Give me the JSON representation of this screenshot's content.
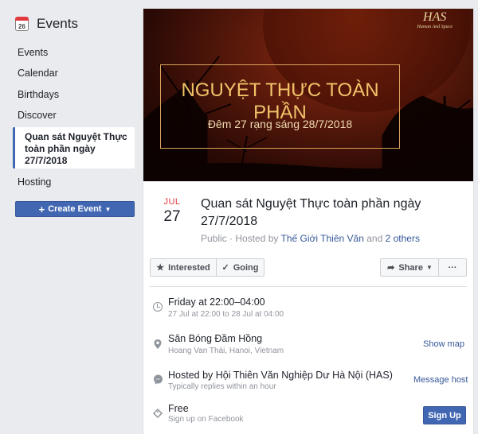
{
  "sidebar": {
    "header_title": "Events",
    "calendar_icon_day": "26",
    "items": [
      {
        "label": "Events"
      },
      {
        "label": "Calendar"
      },
      {
        "label": "Birthdays"
      },
      {
        "label": "Discover"
      },
      {
        "label": "Quan sát Nguyệt Thực toàn phần ngày 27/7/2018"
      },
      {
        "label": "Hosting"
      }
    ],
    "create_button": "Create Event"
  },
  "banner": {
    "logo_mark": "HAS",
    "logo_sub": "Human And Space",
    "title": "NGUYỆT THỰC TOÀN PHẦN",
    "subtitle": "Đêm 27 rạng sáng 28/7/2018"
  },
  "event": {
    "month": "JUL",
    "day": "27",
    "title": "Quan sát Nguyệt Thực toàn phần ngày 27/7/2018",
    "privacy": "Public",
    "hosted_by_prefix": "· Hosted by",
    "host_link": "Thế Giới Thiên Văn",
    "and_text": "and",
    "others_link": "2 others"
  },
  "actions": {
    "interested": "Interested",
    "going": "Going",
    "share": "Share",
    "more": "···"
  },
  "details": {
    "time_main": "Friday at 22:00–04:00",
    "time_sub": "27 Jul at 22:00 to 28 Jul at 04:00",
    "place_main": "Sân Bóng Đầm Hồng",
    "place_sub": "Hoang Van Thái, Hanoi, Vietnam",
    "show_map": "Show map",
    "host_main": "Hosted by Hội Thiên Văn Nghiệp Dư Hà Nội (HAS)",
    "host_sub": "Typically replies within an hour",
    "message_host": "Message host",
    "price_main": "Free",
    "price_sub": "Sign up on Facebook",
    "sign_up": "Sign Up"
  },
  "colors": {
    "brand": "#4267b2",
    "link": "#365899",
    "date_red": "#e0393e"
  }
}
